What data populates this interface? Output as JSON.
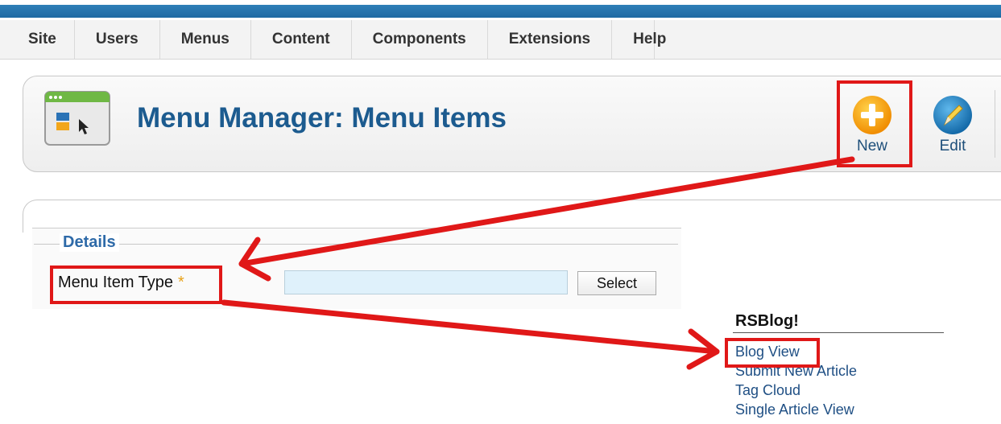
{
  "menubar": {
    "items": [
      {
        "label": "Site"
      },
      {
        "label": "Users"
      },
      {
        "label": "Menus"
      },
      {
        "label": "Content"
      },
      {
        "label": "Components"
      },
      {
        "label": "Extensions"
      },
      {
        "label": "Help"
      }
    ]
  },
  "header": {
    "title": "Menu Manager: Menu Items",
    "icon": "menu-window-icon"
  },
  "toolbar": {
    "new_label": "New",
    "edit_label": "Edit",
    "new_icon": "plus-circle-icon",
    "edit_icon": "pencil-circle-icon"
  },
  "details": {
    "legend": "Details",
    "menu_item_type_label": "Menu Item Type",
    "required_mark": "*",
    "menu_item_type_value": "",
    "select_label": "Select"
  },
  "rsblog": {
    "title": "RSBlog!",
    "items": [
      {
        "label": "Blog View"
      },
      {
        "label": "Submit New Article"
      },
      {
        "label": "Tag Cloud"
      },
      {
        "label": "Single Article View"
      }
    ]
  },
  "colors": {
    "accent": "#1c5b8f",
    "annotation": "#e01818",
    "topbar": "#2577b0",
    "input_bg": "#dff1fb"
  }
}
